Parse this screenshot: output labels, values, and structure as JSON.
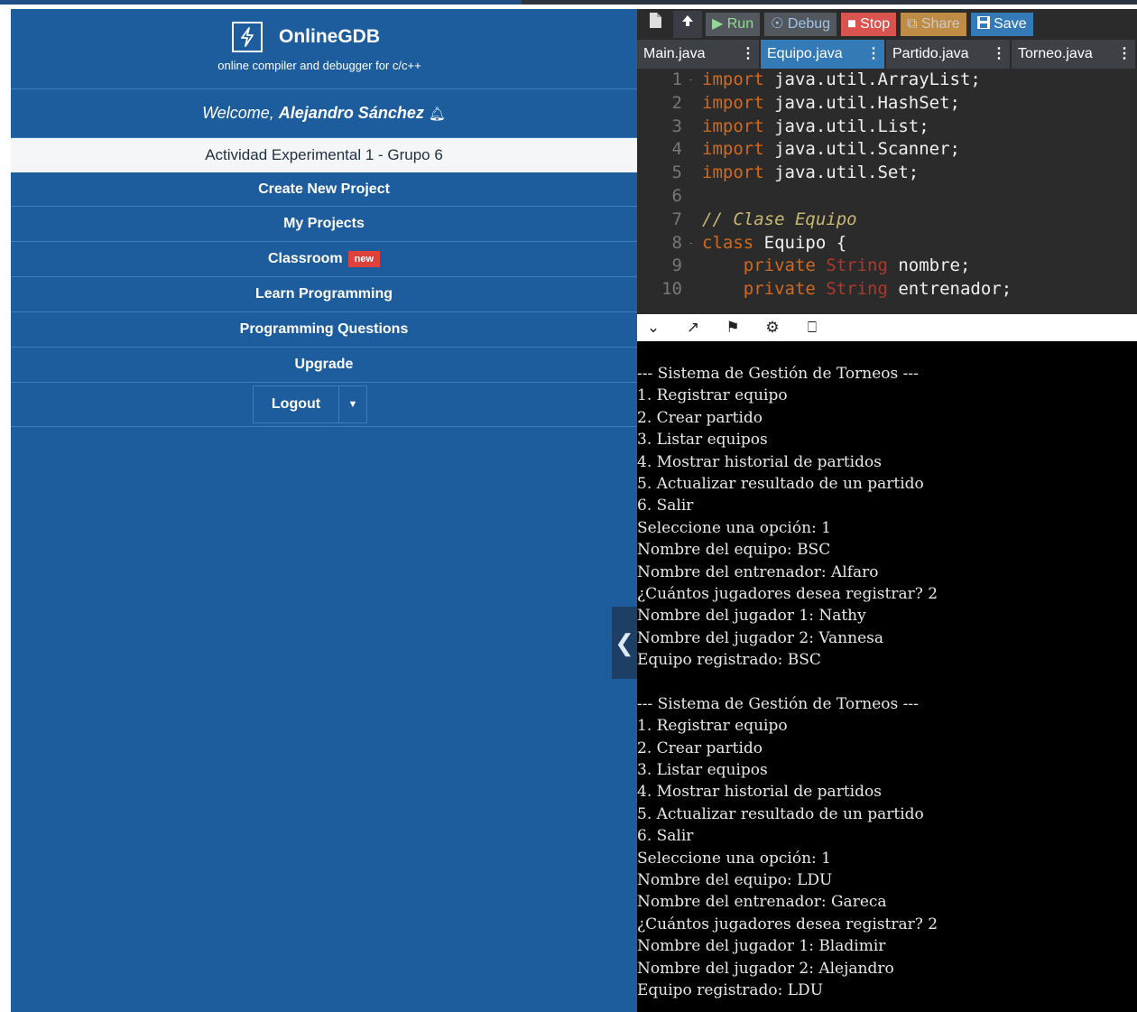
{
  "sidebar": {
    "brand_name": "OnlineGDB",
    "brand_tagline": "online compiler and debugger for c/c++",
    "welcome_prefix": "Welcome, ",
    "user_name": "Alejandro Sánchez",
    "project_name": "Actividad Experimental 1 - Grupo 6",
    "nav": [
      {
        "label": "Create New Project"
      },
      {
        "label": "My Projects"
      },
      {
        "label": "Classroom",
        "badge": "new"
      },
      {
        "label": "Learn Programming"
      },
      {
        "label": "Programming Questions"
      },
      {
        "label": "Upgrade"
      }
    ],
    "logout_label": "Logout",
    "colors": {
      "background": "#1e5d9d",
      "badge": "#e0413a"
    }
  },
  "toolbar": {
    "run": "Run",
    "debug": "Debug",
    "stop": "Stop",
    "share": "Share",
    "save": "Save",
    "icons": [
      "file-icon",
      "upload-icon"
    ]
  },
  "tabs": [
    {
      "label": "Main.java",
      "active": false
    },
    {
      "label": "Equipo.java",
      "active": true
    },
    {
      "label": "Partido.java",
      "active": false
    },
    {
      "label": "Torneo.java",
      "active": false
    }
  ],
  "code_lines": [
    {
      "n": "1",
      "fold": "-",
      "kw": "import",
      "rest": " java.util.ArrayList;"
    },
    {
      "n": "2",
      "fold": "",
      "kw": "import",
      "rest": " java.util.HashSet;"
    },
    {
      "n": "3",
      "fold": "",
      "kw": "import",
      "rest": " java.util.List;"
    },
    {
      "n": "4",
      "fold": "",
      "kw": "import",
      "rest": " java.util.Scanner;"
    },
    {
      "n": "5",
      "fold": "",
      "kw": "import",
      "rest": " java.util.Set;"
    },
    {
      "n": "6",
      "fold": "",
      "kw": "",
      "rest": ""
    },
    {
      "n": "7",
      "fold": "",
      "comment": "// Clase Equipo"
    },
    {
      "n": "8",
      "fold": "-",
      "kw": "class",
      "rest": " Equipo {"
    },
    {
      "n": "9",
      "fold": "",
      "indent": "    ",
      "kw": "private",
      "type": " String",
      "rest": " nombre;"
    },
    {
      "n": "10",
      "fold": "",
      "indent": "    ",
      "kw": "private",
      "type": " String",
      "rest": " entrenador;"
    }
  ],
  "console_icons": [
    "chevron-down-icon",
    "expand-icon",
    "pin-icon",
    "settings-icon",
    "clear-icon"
  ],
  "console_output": [
    "--- Sistema de Gestión de Torneos ---",
    "1. Registrar equipo",
    "2. Crear partido",
    "3. Listar equipos",
    "4. Mostrar historial de partidos",
    "5. Actualizar resultado de un partido",
    "6. Salir",
    "Seleccione una opción: 1",
    "Nombre del equipo: BSC",
    "Nombre del entrenador: Alfaro",
    "¿Cuántos jugadores desea registrar? 2",
    "Nombre del jugador 1: Nathy",
    "Nombre del jugador 2: Vannesa",
    "Equipo registrado: BSC",
    "",
    "--- Sistema de Gestión de Torneos ---",
    "1. Registrar equipo",
    "2. Crear partido",
    "3. Listar equipos",
    "4. Mostrar historial de partidos",
    "5. Actualizar resultado de un partido",
    "6. Salir",
    "Seleccione una opción: 1",
    "Nombre del equipo: LDU",
    "Nombre del entrenador: Gareca",
    "¿Cuántos jugadores desea registrar? 2",
    "Nombre del jugador 1: Bladimir",
    "Nombre del jugador 2: Alejandro",
    "Equipo registrado: LDU"
  ]
}
